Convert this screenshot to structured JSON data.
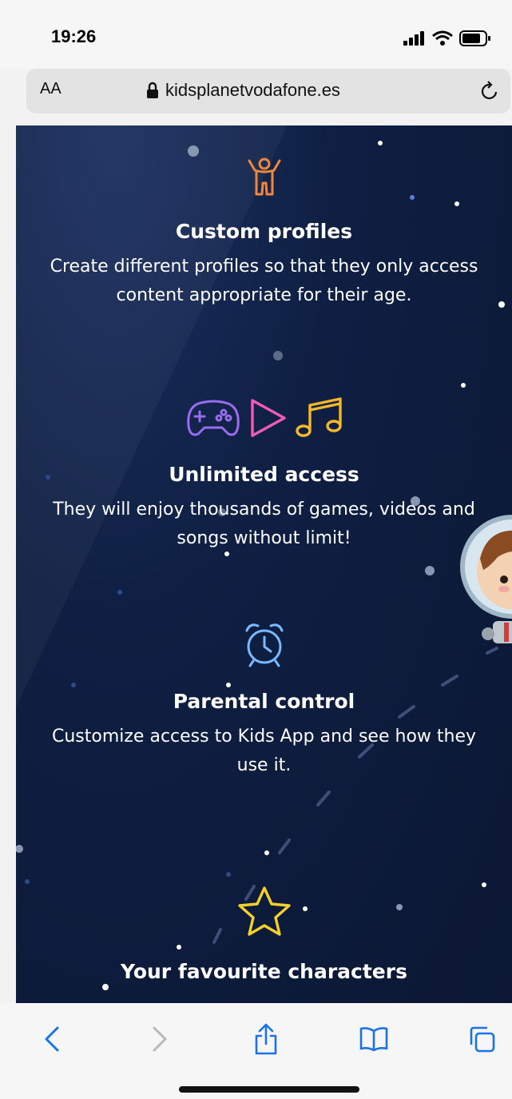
{
  "status_bar": {
    "time": "19:26"
  },
  "url_bar": {
    "text_size_label": "AA",
    "domain": "kidsplanetvodafone.es"
  },
  "features": [
    {
      "title": "Custom profiles",
      "description": "Create different profiles so that they only access content appropriate for their age."
    },
    {
      "title": "Unlimited access",
      "description": "They will enjoy thousands of games, videos and songs without limit!"
    },
    {
      "title": "Parental control",
      "description": "Customize access to Kids App and see how they use it."
    },
    {
      "title": "Your favourite characters"
    }
  ],
  "icons": {
    "profile": "person-arms-up-icon",
    "games": "gamepad-icon",
    "video": "play-icon",
    "music": "music-note-icon",
    "clock": "alarm-clock-icon",
    "star": "star-icon"
  },
  "colors": {
    "background": "#0f1f43",
    "profile_icon": "#f0873a",
    "gamepad_icon": "#9a6cf0",
    "play_icon": "#f05bb6",
    "music_icon": "#f5b82a",
    "clock_icon": "#7ab8ff",
    "star_icon": "#f5d02a"
  }
}
